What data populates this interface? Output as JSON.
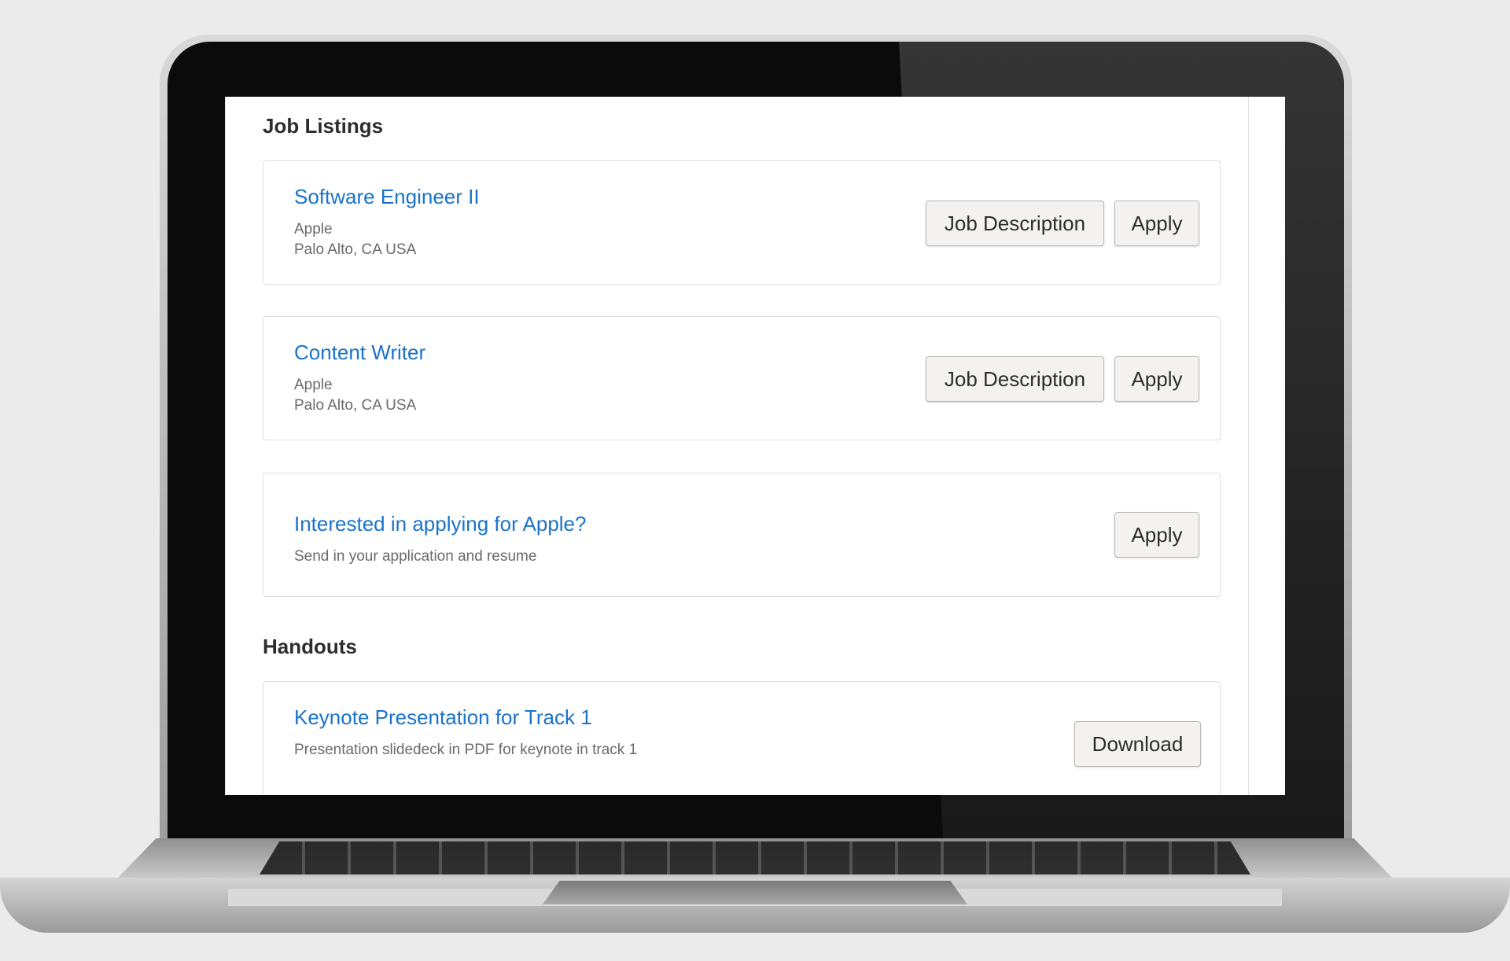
{
  "job_listings": {
    "title": "Job Listings",
    "items": [
      {
        "title": "Software Engineer II",
        "company": "Apple",
        "location": "Palo Alto, CA USA",
        "job_description_label": "Job Description",
        "apply_label": "Apply"
      },
      {
        "title": "Content Writer",
        "company": "Apple",
        "location": "Palo Alto, CA USA",
        "job_description_label": "Job Description",
        "apply_label": "Apply"
      }
    ],
    "general": {
      "title": "Interested in applying for Apple?",
      "subtitle": "Send in your application and resume",
      "apply_label": "Apply"
    }
  },
  "handouts": {
    "title": "Handouts",
    "items": [
      {
        "title": "Keynote Presentation for Track 1",
        "description": "Presentation slidedeck in PDF for keynote in track 1",
        "download_label": "Download"
      }
    ]
  },
  "colors": {
    "link": "#1a73c9",
    "heading": "#2d2d2d",
    "muted": "#6a6a6a",
    "button_bg": "#f3f2f0"
  }
}
